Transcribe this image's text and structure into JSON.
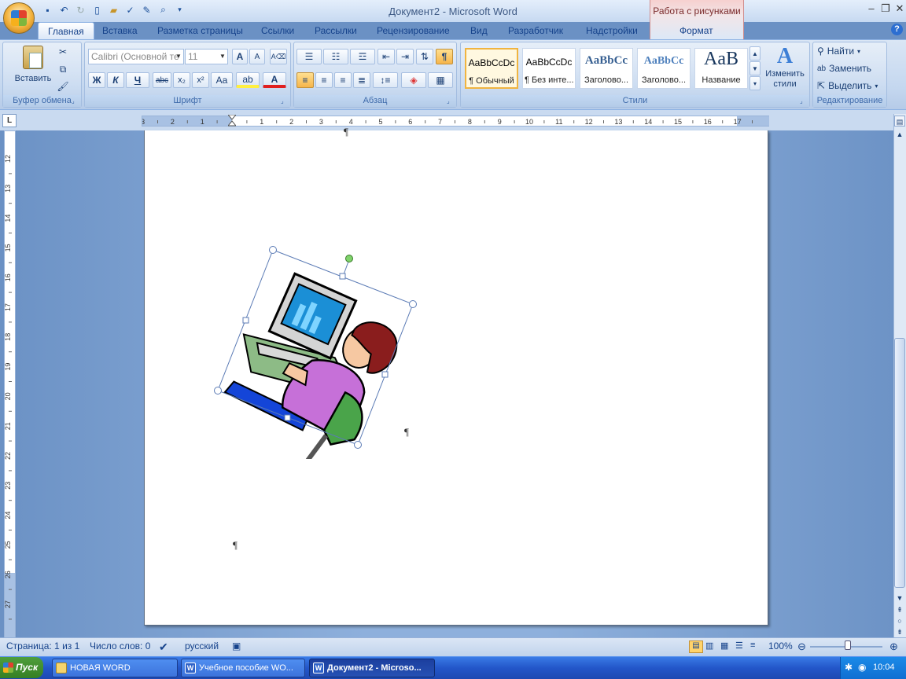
{
  "title_bar": {
    "document_title": "Документ2 - Microsoft Word",
    "context_tab_group": "Работа с рисунками",
    "window_controls": [
      "minimize-icon",
      "restore-icon",
      "close-icon"
    ]
  },
  "quick_access": [
    "save-icon",
    "undo-icon",
    "redo-icon",
    "new-doc-icon",
    "open-icon",
    "spelling-icon",
    "edit-icon",
    "print-preview-icon",
    "customize-icon"
  ],
  "tabs": [
    {
      "label": "Главная",
      "active": true
    },
    {
      "label": "Вставка"
    },
    {
      "label": "Разметка страницы"
    },
    {
      "label": "Ссылки"
    },
    {
      "label": "Рассылки"
    },
    {
      "label": "Рецензирование"
    },
    {
      "label": "Вид"
    },
    {
      "label": "Разработчик"
    },
    {
      "label": "Надстройки"
    },
    {
      "label": "Формат"
    }
  ],
  "ribbon": {
    "clipboard": {
      "label": "Буфер обмена",
      "paste": "Вставить"
    },
    "font": {
      "label": "Шрифт",
      "name": "Calibri (Основной те",
      "size": "11",
      "bold": "Ж",
      "italic": "К",
      "underline": "Ч",
      "strike": "abc",
      "sub": "x₂",
      "sup": "x²",
      "case": "Aa",
      "grow": "A",
      "shrink": "A"
    },
    "paragraph": {
      "label": "Абзац",
      "show_marks": "¶"
    },
    "styles": {
      "label": "Стили",
      "items": [
        {
          "preview": "AaBbCcDc",
          "name": "¶ Обычный",
          "selected": true
        },
        {
          "preview": "AaBbCcDc",
          "name": "¶ Без инте..."
        },
        {
          "preview": "AaBbCc",
          "name": "Заголово..."
        },
        {
          "preview": "AaBbCc",
          "name": "Заголово..."
        },
        {
          "preview": "AaB",
          "name": "Название"
        }
      ],
      "change": "Изменить стили"
    },
    "editing": {
      "label": "Редактирование",
      "find": "Найти",
      "replace": "Заменить",
      "select": "Выделить"
    }
  },
  "hruler_numbers": [
    "3",
    "2",
    "1",
    "1",
    "2",
    "3",
    "4",
    "5",
    "6",
    "7",
    "8",
    "9",
    "10",
    "11",
    "12",
    "13",
    "14",
    "15",
    "16",
    "17"
  ],
  "vruler_numbers": [
    "12",
    "13",
    "14",
    "15",
    "16",
    "17",
    "18",
    "19",
    "20",
    "21",
    "22",
    "23",
    "24",
    "25",
    "26",
    "27"
  ],
  "status": {
    "page": "Страница: 1 из 1",
    "words": "Число слов: 0",
    "language": "русский",
    "zoom": "100%"
  },
  "taskbar": {
    "start": "Пуск",
    "items": [
      {
        "label": "НОВАЯ WORD"
      },
      {
        "label": "Учебное пособие WO..."
      },
      {
        "label": "Документ2 - Microso...",
        "active": true
      }
    ],
    "clock": "10:04"
  },
  "colors": {
    "accent": "#15428b",
    "ribbon": "#c4d7ef",
    "selection": "#f6b54b",
    "context": "#f2c6c6"
  }
}
